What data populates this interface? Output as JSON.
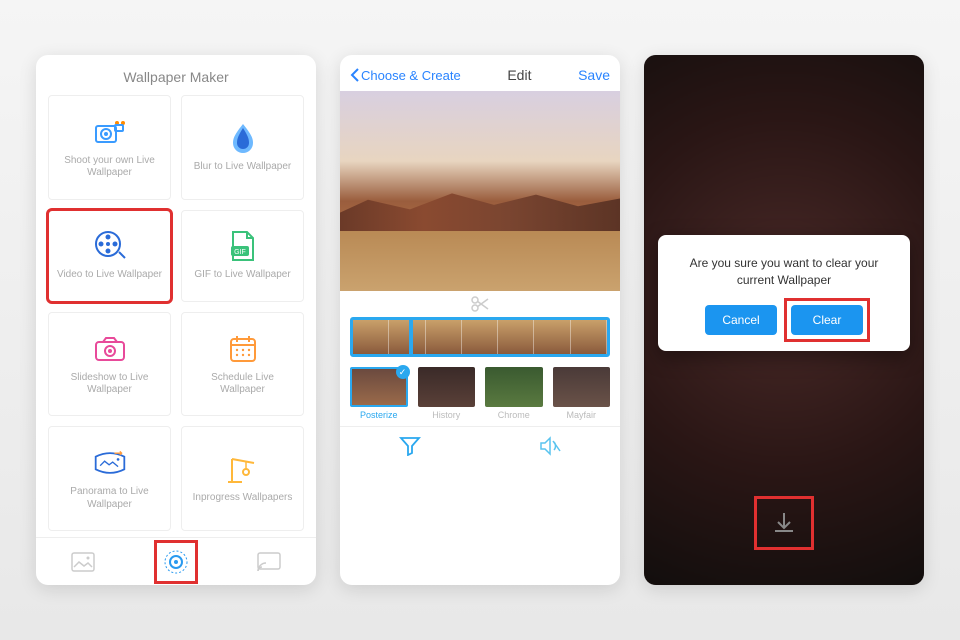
{
  "left": {
    "title": "Wallpaper Maker",
    "cells": [
      {
        "label": "Shoot your own Live Wallpaper"
      },
      {
        "label": "Blur to Live Wallpaper"
      },
      {
        "label": "Video to Live Wallpaper"
      },
      {
        "label": "GIF to Live Wallpaper"
      },
      {
        "label": "Slideshow to Live Wallpaper"
      },
      {
        "label": "Schedule Live Wallpaper"
      },
      {
        "label": "Panorama to Live Wallpaper"
      },
      {
        "label": "Inprogress Wallpapers"
      }
    ]
  },
  "middle": {
    "back": "Choose & Create",
    "title": "Edit",
    "save": "Save",
    "filters": [
      {
        "name": "Posterize"
      },
      {
        "name": "History"
      },
      {
        "name": "Chrome"
      },
      {
        "name": "Mayfair"
      }
    ]
  },
  "right": {
    "dialog_text": "Are you sure you want to clear your current Wallpaper",
    "cancel": "Cancel",
    "clear": "Clear"
  }
}
